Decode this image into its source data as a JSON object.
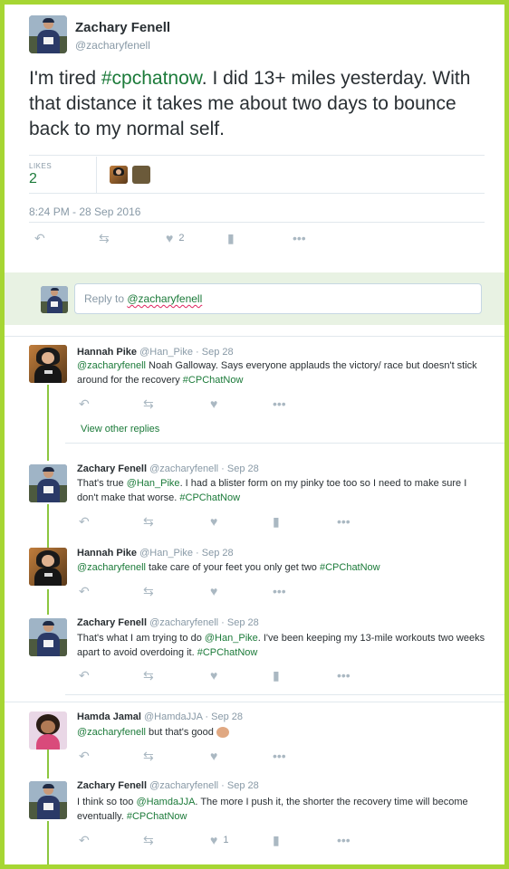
{
  "main_tweet": {
    "name": "Zachary Fenell",
    "handle": "@zacharyfenell",
    "text_parts": [
      "I'm tired ",
      "#cpchatnow",
      ". I did 13+ miles yesterday. With that distance it takes me about two days to bounce back to my normal self."
    ],
    "likes_label": "LIKES",
    "likes_count": "2",
    "timestamp": "8:24 PM - 28 Sep 2016",
    "like_action_count": "2"
  },
  "reply_box": {
    "prefix": "Reply to ",
    "mention": "@zacharyfenell"
  },
  "replies": [
    {
      "name": "Hannah Pike",
      "handle": "@Han_Pike",
      "date": "Sep 28",
      "parts": [
        {
          "t": "@zacharyfenell",
          "k": "mention"
        },
        {
          "t": " Noah Galloway. Says everyone applauds the victory/ race but doesn't stick around for the recovery ",
          "k": "text"
        },
        {
          "t": "#CPChatNow",
          "k": "hashtag"
        }
      ],
      "view_other_replies": "View other replies"
    },
    {
      "name": "Zachary Fenell",
      "handle": "@zacharyfenell",
      "date": "Sep 28",
      "parts": [
        {
          "t": "That's true ",
          "k": "text"
        },
        {
          "t": "@Han_Pike",
          "k": "mention"
        },
        {
          "t": ". I had a blister form on my pinky toe too so I need to make sure I don't make that worse. ",
          "k": "text"
        },
        {
          "t": "#CPChatNow",
          "k": "hashtag"
        }
      ]
    },
    {
      "name": "Hannah Pike",
      "handle": "@Han_Pike",
      "date": "Sep 28",
      "parts": [
        {
          "t": "@zacharyfenell",
          "k": "mention"
        },
        {
          "t": " take care of your feet you only get two ",
          "k": "text"
        },
        {
          "t": "#CPChatNow",
          "k": "hashtag"
        }
      ]
    },
    {
      "name": "Zachary Fenell",
      "handle": "@zacharyfenell",
      "date": "Sep 28",
      "parts": [
        {
          "t": "That's what I am trying to do ",
          "k": "text"
        },
        {
          "t": "@Han_Pike",
          "k": "mention"
        },
        {
          "t": ". I've been keeping my 13-mile workouts two weeks apart to avoid overdoing it. ",
          "k": "text"
        },
        {
          "t": "#CPChatNow",
          "k": "hashtag"
        }
      ]
    },
    {
      "name": "Hamda Jamal",
      "handle": "@HamdaJJA",
      "date": "Sep 28",
      "parts": [
        {
          "t": "@zacharyfenell",
          "k": "mention"
        },
        {
          "t": " but that's good ",
          "k": "text"
        }
      ]
    },
    {
      "name": "Zachary Fenell",
      "handle": "@zacharyfenell",
      "date": "Sep 28",
      "parts": [
        {
          "t": "I think so too ",
          "k": "text"
        },
        {
          "t": "@HamdaJJA",
          "k": "mention"
        },
        {
          "t": ". The more I push it, the shorter the recovery time will become eventually. ",
          "k": "text"
        },
        {
          "t": "#CPChatNow",
          "k": "hashtag"
        }
      ],
      "like_count": "1"
    }
  ],
  "icons": {
    "reply": "reply-icon",
    "retweet": "retweet-icon",
    "like": "heart-icon",
    "analytics": "analytics-icon",
    "more": "more-icon"
  },
  "colors": {
    "accent_green": "#1b7a39",
    "frame_green": "#a6d633",
    "thread_line": "#8cc63f",
    "reply_box_bg": "#e8f2e3"
  }
}
